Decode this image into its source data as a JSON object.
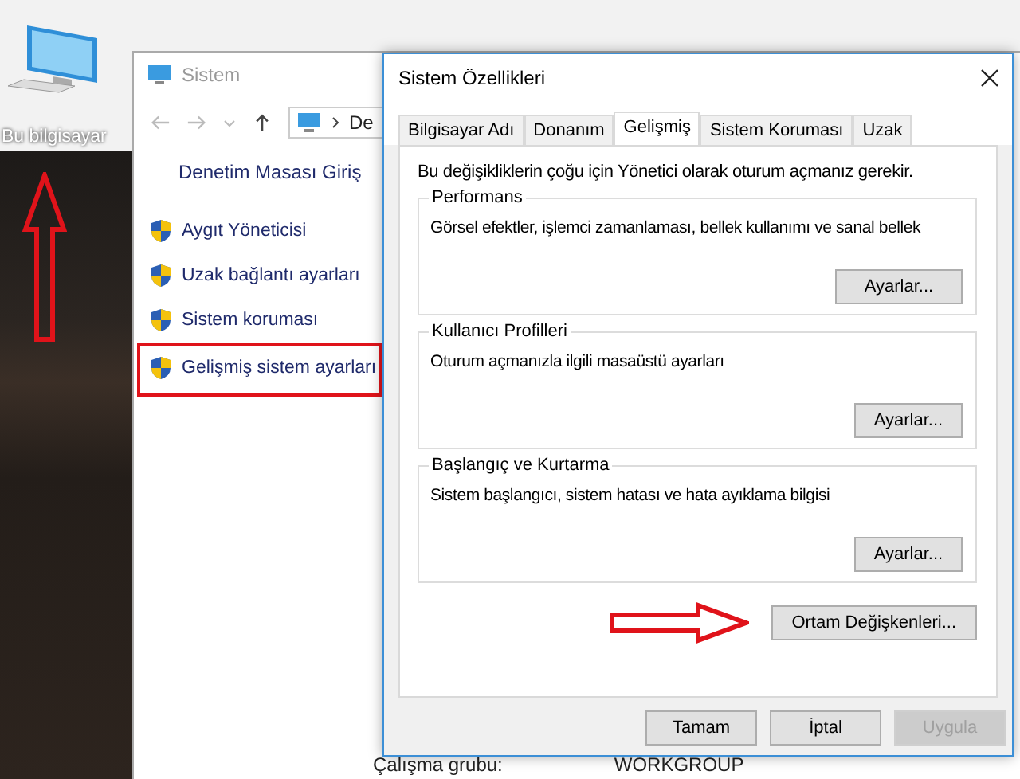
{
  "desktop": {
    "icon_label": "Bu bilgisayar"
  },
  "explorer": {
    "title": "Sistem",
    "breadcrumb": "De",
    "home_link": "Denetim Masası Giriş",
    "links": [
      {
        "label": "Aygıt Yöneticisi",
        "highlighted": false
      },
      {
        "label": "Uzak bağlantı ayarları",
        "highlighted": false
      },
      {
        "label": "Sistem koruması",
        "highlighted": false
      },
      {
        "label": "Gelişmiş sistem ayarları",
        "highlighted": true
      }
    ],
    "details": [
      {
        "label": "Çalışma grubu:",
        "value": "WORKGROUP"
      }
    ]
  },
  "dialog": {
    "title": "Sistem Özellikleri",
    "tabs": [
      {
        "label": "Bilgisayar Adı",
        "selected": false
      },
      {
        "label": "Donanım",
        "selected": false
      },
      {
        "label": "Gelişmiş",
        "selected": true
      },
      {
        "label": "Sistem Koruması",
        "selected": false
      },
      {
        "label": "Uzak",
        "selected": false
      }
    ],
    "notice": "Bu değişikliklerin çoğu için Yönetici olarak oturum açmanız gerekir.",
    "groups": [
      {
        "title": "Performans",
        "description": "Görsel efektler, işlemci zamanlaması, bellek kullanımı ve sanal bellek",
        "button": "Ayarlar..."
      },
      {
        "title": "Kullanıcı Profilleri",
        "description": "Oturum açmanızla ilgili masaüstü ayarları",
        "button": "Ayarlar..."
      },
      {
        "title": "Başlangıç ve Kurtarma",
        "description": "Sistem başlangıcı, sistem hatası ve hata ayıklama bilgisi",
        "button": "Ayarlar..."
      }
    ],
    "env_button": "Ortam Değişkenleri...",
    "buttons": [
      {
        "label": "Tamam",
        "disabled": false
      },
      {
        "label": "İptal",
        "disabled": false
      },
      {
        "label": "Uygula",
        "disabled": true
      }
    ]
  }
}
